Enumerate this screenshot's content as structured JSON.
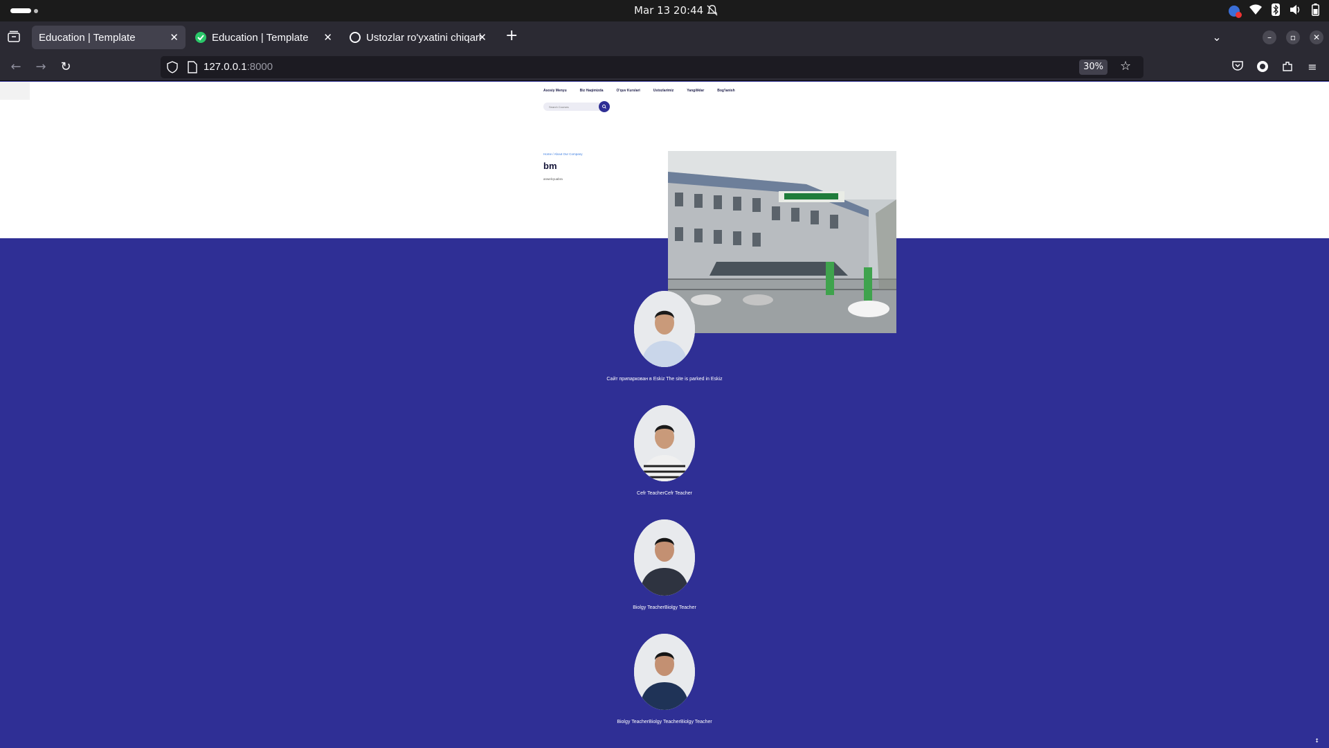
{
  "system": {
    "datetime": "Mar 13  20:44"
  },
  "browser": {
    "tabs": [
      {
        "title": "Education | Template",
        "active": true
      },
      {
        "title": "Education | Template",
        "active": false
      },
      {
        "title": "Ustozlar ro'yxatini chiqari",
        "active": false
      }
    ],
    "url_host": "127.0.0.1",
    "url_port": ":8000",
    "zoom": "30%"
  },
  "site": {
    "nav": [
      "Asosiy Menyu",
      "Biz Haqimizda",
      "O'quv Kurslari",
      "Ustozlarimiz",
      "Yangiliklar",
      "Bog'lanish"
    ],
    "search_placeholder": "Search Courses",
    "breadcrumb": "Home / About Our Company",
    "hero_title": "bm",
    "hero_sub": "anwelcyuabra"
  },
  "teachers": [
    {
      "name": "Сайт припаркован в Eskiz The site is parked in Eskiz",
      "shirt": "#c9d6ea"
    },
    {
      "name": "Cefr TeacherCefr Teacher",
      "shirt": "#f0f0f0"
    },
    {
      "name": "Biolgy TeacherBiolgy Teacher",
      "shirt": "#2e3340"
    },
    {
      "name": "Biolgy TeacherBiolgy TeacherBiolgy Teacher",
      "shirt": "#1f3357"
    }
  ],
  "colors": {
    "brand": "#2f2f95",
    "chrome": "#2b2a33"
  }
}
